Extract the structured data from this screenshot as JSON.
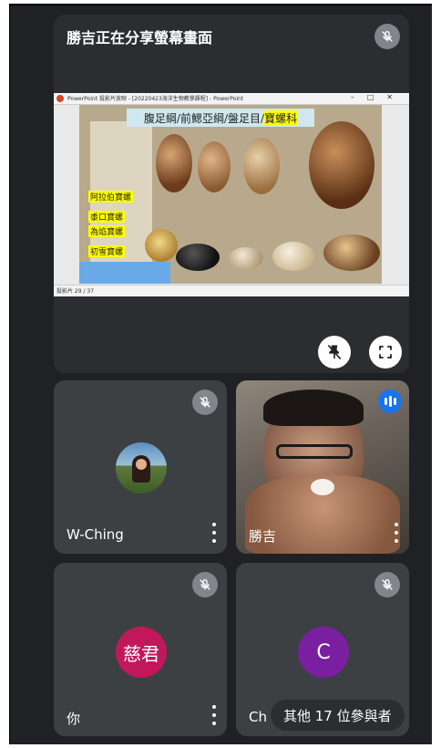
{
  "presentation": {
    "title": "勝吉正在分享螢幕畫面",
    "window_title": "PowerPoint 投影片放映 - [20220423海洋生物教學課程] - PowerPoint",
    "slide_heading_a": "腹足綱/前鰓亞綱/盤足目/",
    "slide_heading_b": "寶螺科",
    "slide_status": "投影片 29 / 37",
    "slide_labels": [
      "阿拉伯寶螺",
      "黍口寶螺",
      "為焰寶螺",
      "初雪寶螺"
    ]
  },
  "participants": [
    {
      "name": "W-Ching"
    },
    {
      "name": "勝吉"
    },
    {
      "name": "你",
      "avatar_text": "慈君",
      "avatar_color": "#c2185b"
    },
    {
      "name": "Ch",
      "avatar_text": "C",
      "avatar_color": "#7b1fa2"
    }
  ],
  "others_pill": "其他 17 位參與者",
  "colors": {
    "background": "#202124",
    "tile": "#3c4043",
    "speaking": "#1a73e8"
  }
}
